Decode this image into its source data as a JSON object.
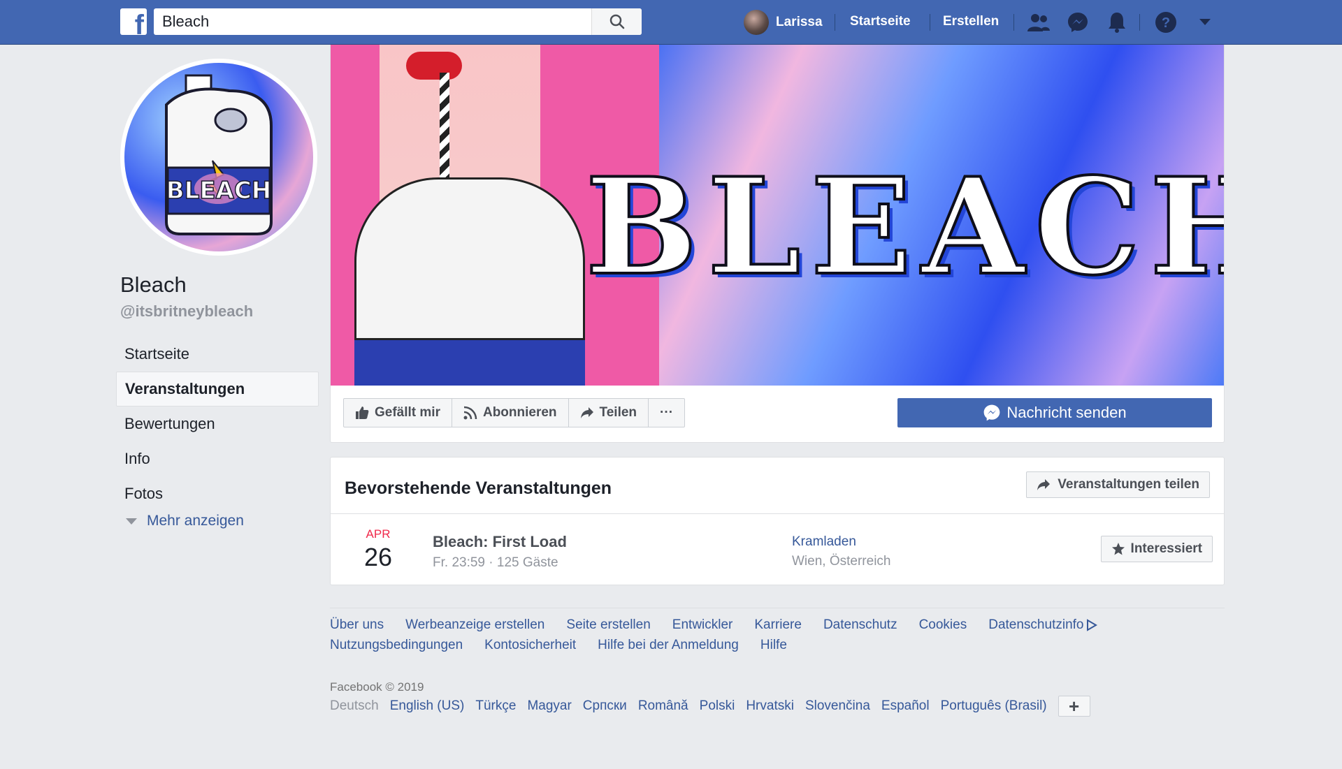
{
  "topbar": {
    "search_value": "Bleach",
    "user_name": "Larissa",
    "home_label": "Startseite",
    "create_label": "Erstellen"
  },
  "page": {
    "name": "Bleach",
    "handle": "@itsbritneybleach",
    "cover_title": "BLEACH",
    "profile_label": "BLEACH"
  },
  "sidebar": {
    "items": [
      {
        "label": "Startseite"
      },
      {
        "label": "Veranstaltungen"
      },
      {
        "label": "Bewertungen"
      },
      {
        "label": "Info"
      },
      {
        "label": "Fotos"
      }
    ],
    "more_label": "Mehr anzeigen"
  },
  "actions": {
    "like": "Gefällt mir",
    "follow": "Abonnieren",
    "share": "Teilen",
    "more": "···",
    "message": "Nachricht senden"
  },
  "events": {
    "title": "Bevorstehende Veranstaltungen",
    "share_label": "Veranstaltungen teilen",
    "items": [
      {
        "month": "APR",
        "day": "26",
        "name": "Bleach: First Load",
        "meta": "Fr. 23:59 · 125 Gäste",
        "venue": "Kramladen",
        "city": "Wien, Österreich",
        "interested_label": "Interessiert"
      }
    ]
  },
  "footer": {
    "links": [
      "Über uns",
      "Werbeanzeige erstellen",
      "Seite erstellen",
      "Entwickler",
      "Karriere",
      "Datenschutz",
      "Cookies",
      "Datenschutzinfo",
      "Nutzungsbedingungen",
      "Kontosicherheit",
      "Hilfe bei der Anmeldung",
      "Hilfe"
    ],
    "copyright": "Facebook © 2019",
    "current_language": "Deutsch",
    "languages": [
      "English (US)",
      "Türkçe",
      "Magyar",
      "Српски",
      "Română",
      "Polski",
      "Hrvatski",
      "Slovenčina",
      "Español",
      "Português (Brasil)"
    ],
    "plus_label": "+"
  },
  "colors": {
    "brand": "#4267b2",
    "background": "#e9ebee",
    "link": "#365899",
    "event_month": "#f0284a"
  }
}
